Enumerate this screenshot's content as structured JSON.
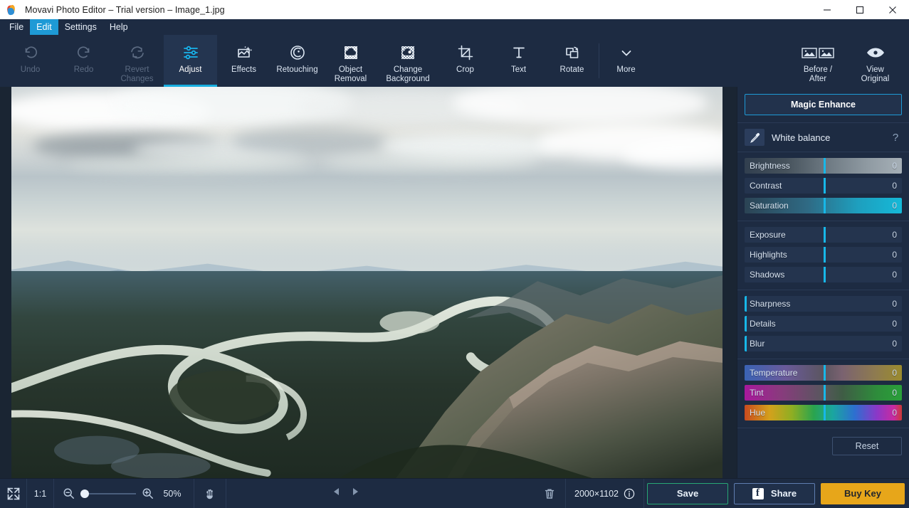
{
  "window": {
    "title": "Movavi Photo Editor – Trial version – Image_1.jpg",
    "logo_icon": "movavi-logo-icon",
    "minimize_label": "–",
    "maximize_label": "□",
    "close_label": "×"
  },
  "menubar": {
    "items": [
      {
        "label": "File",
        "active": false
      },
      {
        "label": "Edit",
        "active": true
      },
      {
        "label": "Settings",
        "active": false
      },
      {
        "label": "Help",
        "active": false
      }
    ]
  },
  "toolbar": {
    "history": [
      {
        "label": "Undo",
        "icon": "undo-icon",
        "disabled": true
      },
      {
        "label": "Redo",
        "icon": "redo-icon",
        "disabled": true
      },
      {
        "label": "Revert\nChanges",
        "line1": "Revert",
        "line2": "Changes",
        "icon": "revert-icon",
        "disabled": true
      }
    ],
    "tools": [
      {
        "label": "Adjust",
        "line1": "Adjust",
        "line2": "",
        "icon": "sliders-icon",
        "active": true
      },
      {
        "label": "Effects",
        "line1": "Effects",
        "line2": "",
        "icon": "effects-icon",
        "active": false
      },
      {
        "label": "Retouching",
        "line1": "Retouching",
        "line2": "",
        "icon": "retouching-icon",
        "active": false
      },
      {
        "label": "Object Removal",
        "line1": "Object",
        "line2": "Removal",
        "icon": "object-removal-icon",
        "active": false
      },
      {
        "label": "Change Background",
        "line1": "Change",
        "line2": "Background",
        "icon": "change-background-icon",
        "active": false
      },
      {
        "label": "Crop",
        "line1": "Crop",
        "line2": "",
        "icon": "crop-icon",
        "active": false
      },
      {
        "label": "Text",
        "line1": "Text",
        "line2": "",
        "icon": "text-icon",
        "active": false
      },
      {
        "label": "Rotate",
        "line1": "Rotate",
        "line2": "",
        "icon": "rotate-icon",
        "active": false
      },
      {
        "label": "More",
        "line1": "More",
        "line2": "",
        "icon": "chevron-down-icon",
        "active": false
      }
    ],
    "view": [
      {
        "label": "Before / After",
        "line1": "Before /",
        "line2": "After",
        "icon": "before-after-icon"
      },
      {
        "label": "View Original",
        "line1": "View",
        "line2": "Original",
        "icon": "eye-icon"
      }
    ]
  },
  "panel": {
    "magic_enhance_label": "Magic Enhance",
    "white_balance": {
      "label": "White balance",
      "icon": "eyedropper-icon",
      "help_label": "?"
    },
    "groups": [
      {
        "sliders": [
          {
            "name": "Brightness",
            "value": "0",
            "handle_pct": 50,
            "track": "brightness"
          },
          {
            "name": "Contrast",
            "value": "0",
            "handle_pct": 50,
            "track": "plain"
          },
          {
            "name": "Saturation",
            "value": "0",
            "handle_pct": 50,
            "track": "saturation"
          }
        ]
      },
      {
        "sliders": [
          {
            "name": "Exposure",
            "value": "0",
            "handle_pct": 50,
            "track": "plain"
          },
          {
            "name": "Highlights",
            "value": "0",
            "handle_pct": 50,
            "track": "plain"
          },
          {
            "name": "Shadows",
            "value": "0",
            "handle_pct": 50,
            "track": "plain"
          }
        ]
      },
      {
        "sliders": [
          {
            "name": "Sharpness",
            "value": "0",
            "handle_pct": 0,
            "track": "plain"
          },
          {
            "name": "Details",
            "value": "0",
            "handle_pct": 0,
            "track": "plain"
          },
          {
            "name": "Blur",
            "value": "0",
            "handle_pct": 0,
            "track": "plain"
          }
        ]
      },
      {
        "sliders": [
          {
            "name": "Temperature",
            "value": "0",
            "handle_pct": 50,
            "track": "temperature"
          },
          {
            "name": "Tint",
            "value": "0",
            "handle_pct": 50,
            "track": "tint"
          },
          {
            "name": "Hue",
            "value": "0",
            "handle_pct": 50,
            "track": "hue"
          }
        ]
      }
    ],
    "reset_label": "Reset"
  },
  "bottombar": {
    "fit_icon": "fit-to-screen-icon",
    "actual_size_label": "1:1",
    "zoom_out_icon": "zoom-out-icon",
    "zoom_in_icon": "zoom-in-icon",
    "zoom_level": "50%",
    "zoom_slider_pct": 8,
    "hand_icon": "hand-tool-icon",
    "prev_icon": "previous-image-icon",
    "next_icon": "next-image-icon",
    "delete_icon": "trash-icon",
    "dimensions": "2000×1102",
    "info_icon": "info-icon",
    "save_label": "Save",
    "share_label": "Share",
    "share_icon": "facebook-icon",
    "buy_label": "Buy Key"
  },
  "colors": {
    "accent": "#17aee0",
    "panel_bg": "#1d2b42",
    "titlebar_bg": "#ffffff",
    "menu_active": "#1e9ad6",
    "save_border": "#27a775",
    "buy_bg": "#e7a61a"
  }
}
